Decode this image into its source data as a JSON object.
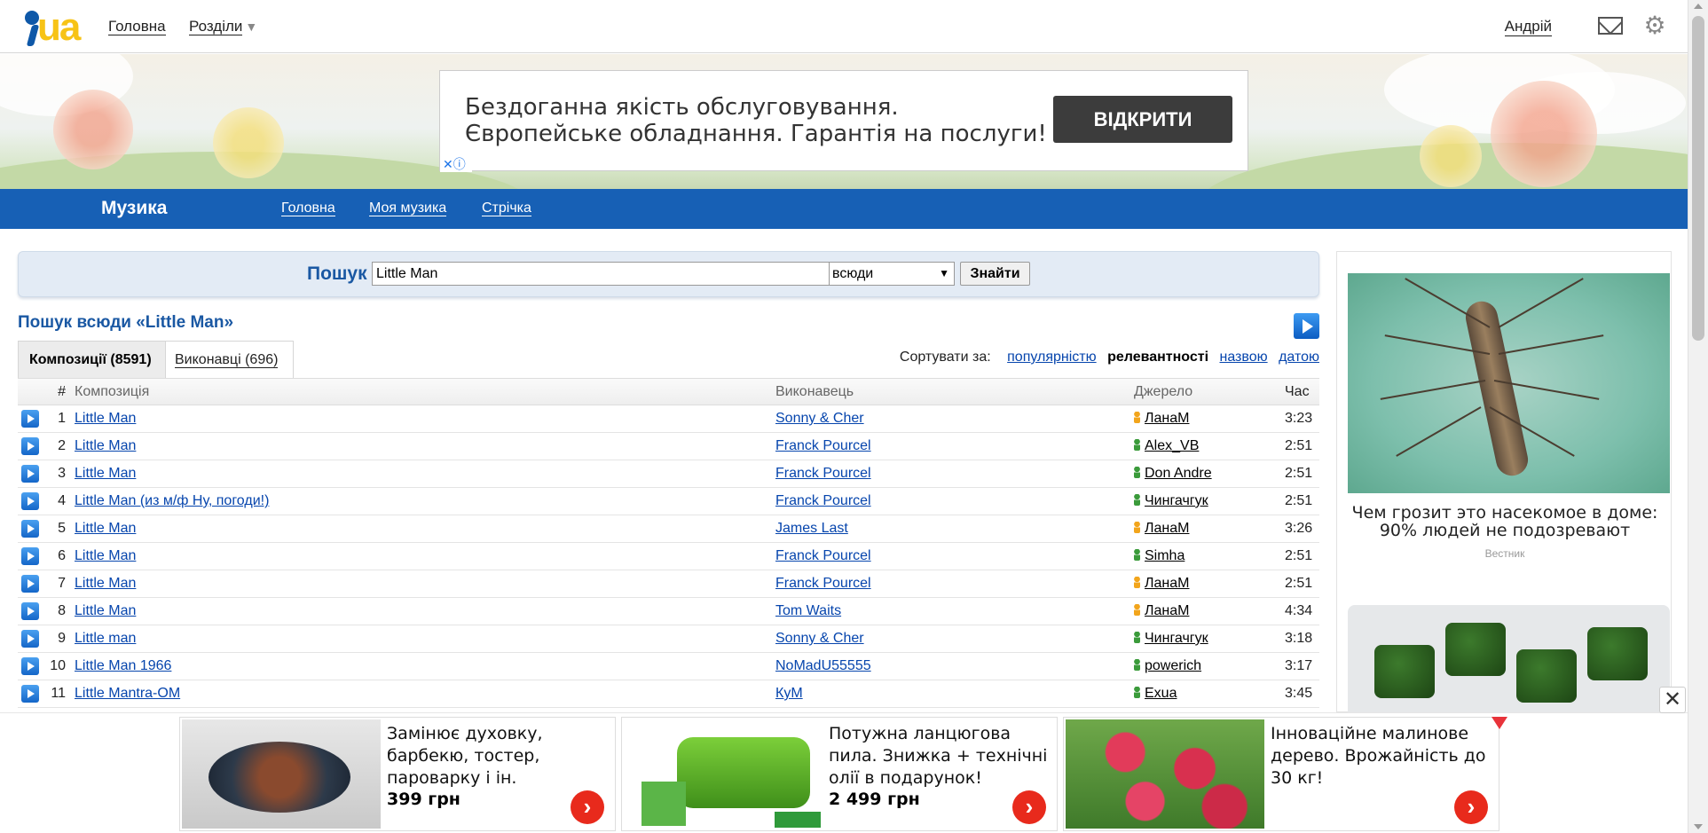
{
  "topbar": {
    "nav_home": "Головна",
    "nav_sections": "Розділи",
    "user": "Андрій",
    "icons": [
      "mail-icon",
      "gear-icon"
    ]
  },
  "banner_ad": {
    "text_line1": "Бездоганна якість обслуговування.",
    "text_line2": "Європейське обладнання. Гарантія на послуги!",
    "button": "ВІДКРИТИ",
    "close": "✕ⓘ"
  },
  "section": {
    "title": "Музика",
    "nav": [
      "Головна",
      "Моя музика",
      "Стрічка"
    ]
  },
  "search": {
    "label": "Пошук",
    "value": "Little Man",
    "scope": "всюди",
    "button": "Знайти"
  },
  "results": {
    "title": "Пошук всюди «Little Man»",
    "tab_compositions": "Композиції (8591)",
    "tab_artists": "Виконавці (696)",
    "sort_label": "Сортувати за:",
    "sort_popularity": "популярністю",
    "sort_relevance": "релевантності",
    "sort_name": "назвою",
    "sort_date": "датою",
    "columns": {
      "num": "#",
      "title": "Композиція",
      "artist": "Виконавець",
      "source": "Джерело",
      "time": "Час"
    },
    "rows": [
      {
        "num": "1",
        "title": "Little Man",
        "artist": "Sonny & Cher",
        "source": "ЛанаМ",
        "gender": "f",
        "time": "3:23"
      },
      {
        "num": "2",
        "title": "Little Man",
        "artist": "Franck Pourcel",
        "source": "Alex_VB",
        "gender": "m",
        "time": "2:51"
      },
      {
        "num": "3",
        "title": "Little Man",
        "artist": "Franck Pourcel",
        "source": "Don Andre",
        "gender": "m",
        "time": "2:51"
      },
      {
        "num": "4",
        "title": "Little Man (из м/ф Ну, погоди!)",
        "artist": "Franck Pourcel",
        "source": "Чингачгук",
        "gender": "m",
        "time": "2:51"
      },
      {
        "num": "5",
        "title": "Little Man",
        "artist": "James Last",
        "source": "ЛанаМ",
        "gender": "f",
        "time": "3:26"
      },
      {
        "num": "6",
        "title": "Little Man",
        "artist": "Franck Pourcel",
        "source": "Simha",
        "gender": "m",
        "time": "2:51"
      },
      {
        "num": "7",
        "title": "Little Man",
        "artist": "Franck Pourcel",
        "source": "ЛанаМ",
        "gender": "f",
        "time": "2:51"
      },
      {
        "num": "8",
        "title": "Little Man",
        "artist": "Tom Waits",
        "source": "ЛанаМ",
        "gender": "f",
        "time": "4:34"
      },
      {
        "num": "9",
        "title": "Little man",
        "artist": "Sonny & Cher",
        "source": "Чингачгук",
        "gender": "m",
        "time": "3:18"
      },
      {
        "num": "10",
        "title": "Little Man 1966",
        "artist": "NoMadU55555",
        "source": "powerich",
        "gender": "m",
        "time": "3:17"
      },
      {
        "num": "11",
        "title": "Little Mantra-OM",
        "artist": "КуМ",
        "source": "Exua",
        "gender": "m",
        "time": "3:45"
      }
    ]
  },
  "side_ad": {
    "caption": "Чем грозит это насекомое в доме: 90% людей не подозревают",
    "source": "Вестник"
  },
  "bottom_ads": [
    {
      "text": "Замінює духовку, барбекю, тостер, пароварку і ін.",
      "price": "399 грн"
    },
    {
      "text": "Потужна ланцюгова пила. Знижка + технічні олії в подарунок!",
      "price": "2 499 грн"
    },
    {
      "text": "Інноваційне малинове дерево. Врожайність до 30 кг!",
      "price": ""
    }
  ],
  "bottom_close": "✕",
  "colors": {
    "brand_blue": "#1760b5",
    "link": "#0645ad",
    "cta_red": "#e82a1c",
    "logo_yellow": "#f7c316"
  }
}
